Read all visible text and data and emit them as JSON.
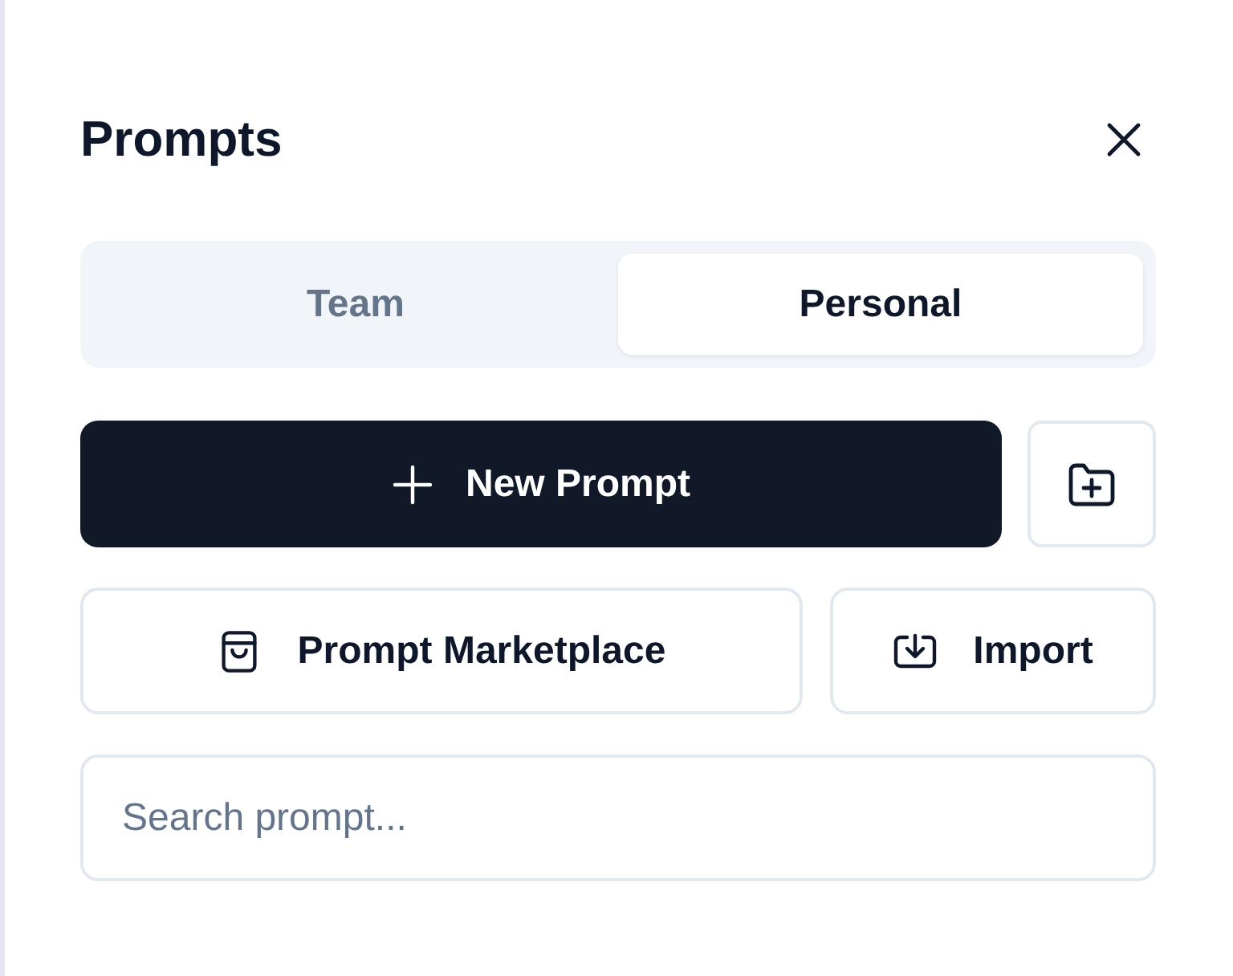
{
  "header": {
    "title": "Prompts"
  },
  "tabs": [
    {
      "label": "Team",
      "selected": false
    },
    {
      "label": "Personal",
      "selected": true
    }
  ],
  "primary_row": {
    "new_button": {
      "label": "New Prompt"
    }
  },
  "secondary_buttons": [
    {
      "label": "Prompt Marketplace"
    },
    {
      "label": "Import"
    }
  ],
  "search": {
    "placeholder": "Search prompt..."
  }
}
